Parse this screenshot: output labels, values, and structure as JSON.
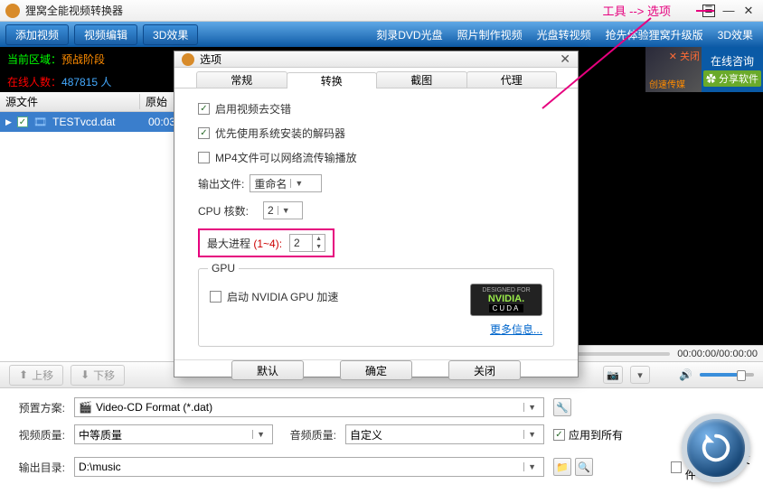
{
  "titlebar": {
    "title": "狸窝全能视频转换器"
  },
  "annotation": "工具 --> 选项",
  "toolbar": {
    "add": "添加视频",
    "edit": "视频编辑",
    "fx": "3D效果",
    "m1": "刻录DVD光盘",
    "m2": "照片制作视频",
    "m3": "光盘转视频",
    "m4": "抢先体验狸窝升级版",
    "m5": "3D效果"
  },
  "banner": {
    "l1a": "当前区域：",
    "l1b": "预战阶段",
    "l2a": "在线人数：",
    "l2b": "487815 人",
    "close": "✕ 关闭",
    "consult": "在线咨询",
    "cs": "创速传媒",
    "share": "✿ 分享软件"
  },
  "cols": {
    "c1": "源文件",
    "c2": "原始"
  },
  "file": {
    "name": "TESTvcd.dat",
    "time": "00:03"
  },
  "timecode": "00:00:00/00:00:00",
  "dialog": {
    "title": "选项",
    "tabs": {
      "t1": "常规",
      "t2": "转换",
      "t3": "截图",
      "t4": "代理"
    },
    "opt1": "启用视频去交错",
    "opt2": "优先使用系统安装的解码器",
    "opt3": "MP4文件可以网络流传输播放",
    "outlabel": "输出文件:",
    "outval": "重命名",
    "cpulabel": "CPU 核数:",
    "cpuval": "2",
    "maxlabel": "最大进程",
    "maxrange": "(1~4):",
    "maxval": "2",
    "gpu": "GPU",
    "gpuopt": "启动 NVIDIA GPU 加速",
    "cuda1": "DESIGNED FOR",
    "cuda2": "NVIDIA.",
    "cuda3": "CUDA",
    "more": "更多信息...",
    "b1": "默认",
    "b2": "确定",
    "b3": "关闭"
  },
  "ctrl": {
    "up": "上移",
    "down": "下移"
  },
  "settings": {
    "preset_l": "预置方案:",
    "preset_v": "Video-CD Format (*.dat)",
    "vq_l": "视频质量:",
    "vq_v": "中等质量",
    "aq_l": "音频质量:",
    "aq_v": "自定义",
    "apply": "应用到所有",
    "out_l": "输出目录:",
    "out_v": "D:\\music",
    "merge": "合并成一个文件"
  }
}
